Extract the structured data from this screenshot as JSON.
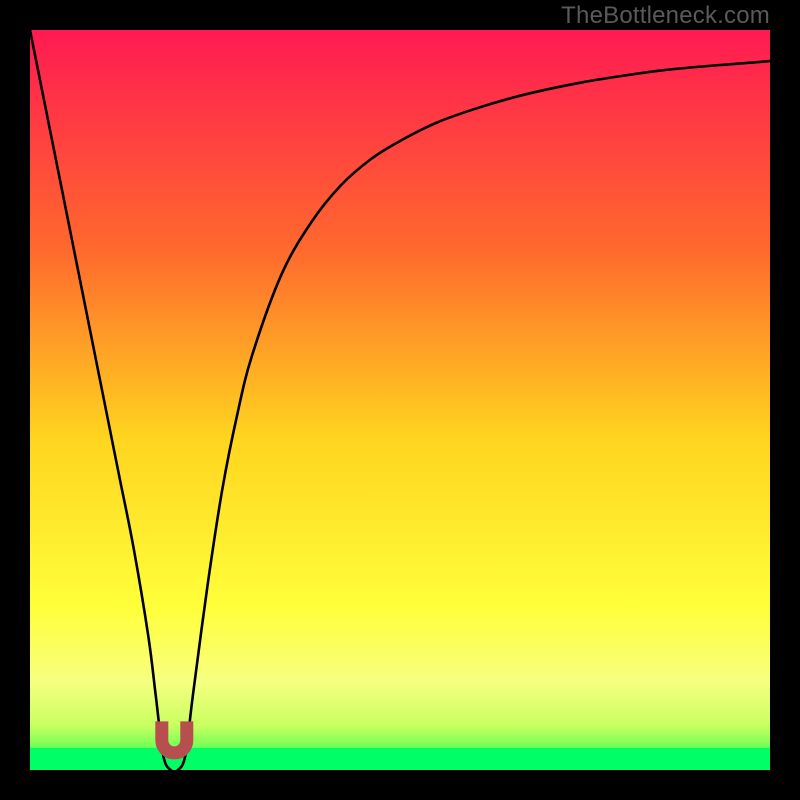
{
  "watermark": "TheBottleneck.com",
  "chart_data": {
    "type": "line",
    "title": "",
    "xlabel": "",
    "ylabel": "",
    "xlim": [
      0,
      100
    ],
    "ylim": [
      0,
      100
    ],
    "series": [
      {
        "name": "curve",
        "x": [
          0,
          2,
          4,
          6,
          8,
          10,
          12,
          14,
          16,
          17,
          18,
          19,
          20,
          21,
          22,
          24,
          26,
          28,
          30,
          34,
          38,
          42,
          46,
          50,
          55,
          60,
          65,
          70,
          75,
          80,
          85,
          90,
          95,
          100
        ],
        "values": [
          100,
          90,
          80,
          70,
          60,
          50,
          40,
          30,
          18,
          10,
          2,
          0,
          0,
          2,
          10,
          25,
          38,
          48,
          56,
          67,
          74,
          79,
          82.5,
          85,
          87.5,
          89.3,
          90.8,
          92,
          93,
          93.8,
          94.5,
          95,
          95.4,
          95.8
        ]
      }
    ],
    "marker": {
      "x": 19.5,
      "y": 1.5,
      "width": 5,
      "height": 5,
      "color": "#b84f4f"
    },
    "green_band": {
      "y0": 0,
      "y1": 3
    },
    "background_gradient": {
      "stops": [
        {
          "offset": 0,
          "color": "#ff1a52"
        },
        {
          "offset": 0.3,
          "color": "#ff6a2d"
        },
        {
          "offset": 0.55,
          "color": "#ffd41f"
        },
        {
          "offset": 0.78,
          "color": "#ffff3a"
        },
        {
          "offset": 0.88,
          "color": "#f7ff80"
        },
        {
          "offset": 0.94,
          "color": "#c8ff60"
        },
        {
          "offset": 0.97,
          "color": "#70ff55"
        },
        {
          "offset": 1.0,
          "color": "#00ff66"
        }
      ]
    }
  }
}
